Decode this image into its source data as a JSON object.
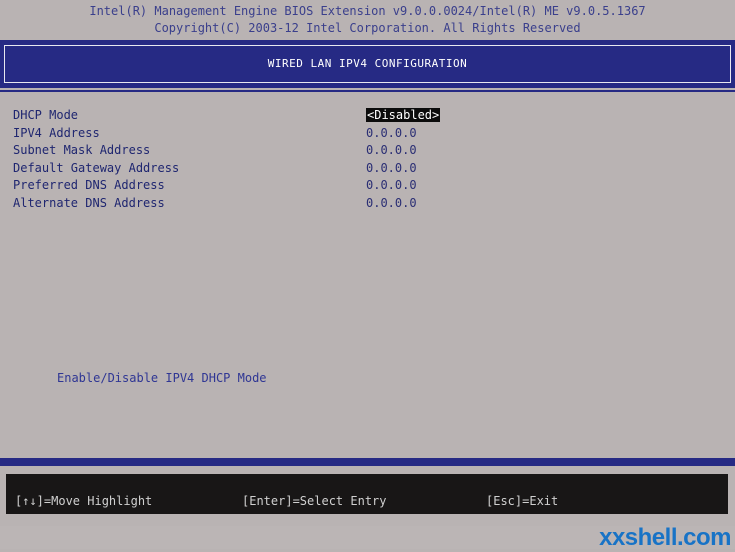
{
  "header": {
    "line1": "Intel(R) Management Engine BIOS Extension v9.0.0.0024/Intel(R) ME v9.0.5.1367",
    "line2": "Copyright(C) 2003-12 Intel Corporation. All Rights Reserved"
  },
  "title": "WIRED LAN IPV4 CONFIGURATION",
  "settings": [
    {
      "label": "DHCP Mode",
      "value": "<Disabled>"
    },
    {
      "label": "IPV4 Address",
      "value": "0.0.0.0"
    },
    {
      "label": "Subnet Mask Address",
      "value": "0.0.0.0"
    },
    {
      "label": "Default Gateway Address",
      "value": "0.0.0.0"
    },
    {
      "label": "Preferred DNS Address",
      "value": "0.0.0.0"
    },
    {
      "label": "Alternate DNS Address",
      "value": "0.0.0.0"
    }
  ],
  "help_text": "Enable/Disable IPV4 DHCP Mode",
  "footer": {
    "move": "[↑↓]=Move Highlight",
    "enter": "[Enter]=Select Entry",
    "esc": "[Esc]=Exit"
  },
  "watermark": "xxshell.com",
  "colors": {
    "background": "#b9b3b3",
    "title_bar": "#262a84",
    "footer": "#181616",
    "selection": "#0c0c0c"
  }
}
